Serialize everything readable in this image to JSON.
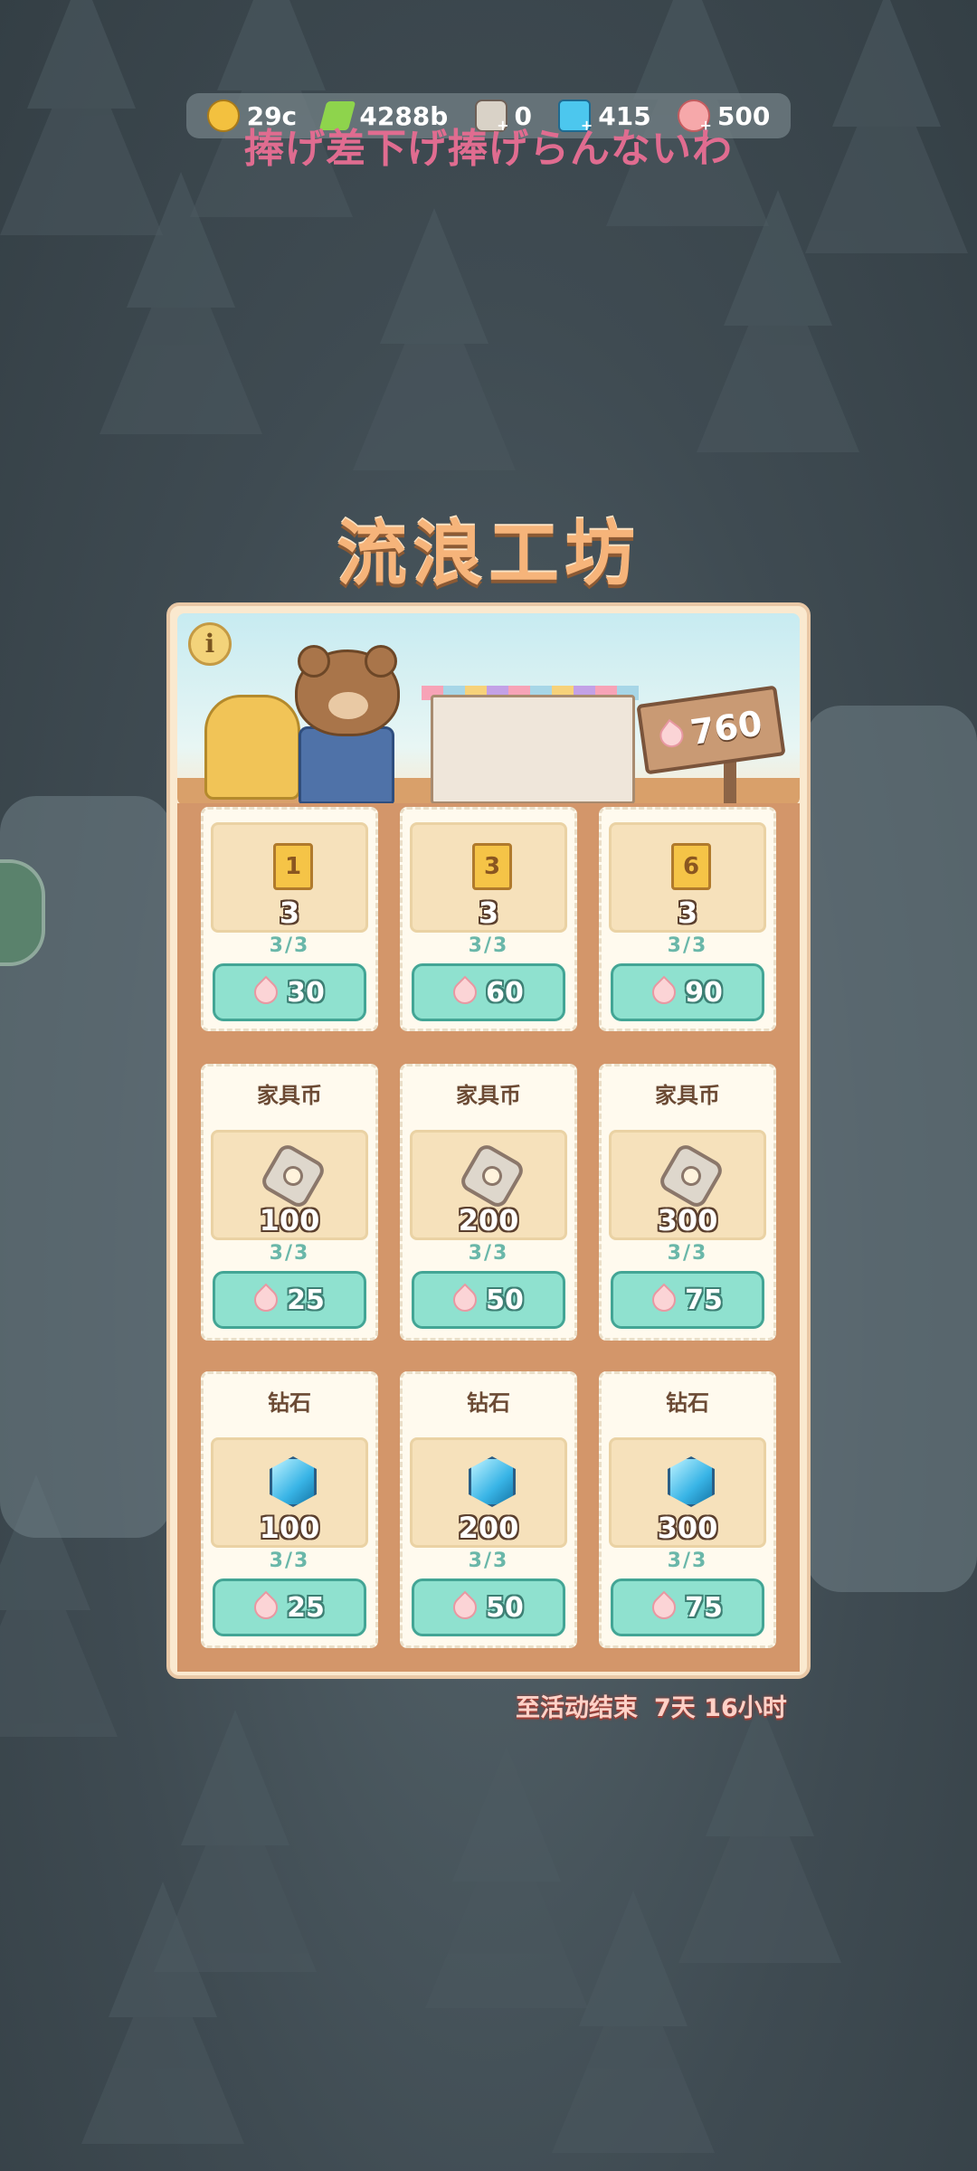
{
  "hud": {
    "coins": "29c",
    "energy": "4288b",
    "furniture_coins": "0",
    "diamonds": "415",
    "petals": "500",
    "colors": {
      "coin": "#f3c13f",
      "energy": "#8ed44c",
      "nut": "#d9d2c7",
      "diamond": "#4cc7ee",
      "petal": "#f6a8aa"
    }
  },
  "overlay_text": "捧げ差下げ捧げらんないわ",
  "title": "流浪工坊",
  "banner": {
    "info_label": "i",
    "currency_amount": "760"
  },
  "cards": [
    {
      "head": "",
      "type": "ticket",
      "ticket_num": "1",
      "amount": "3",
      "limit": "3/3",
      "price": "30"
    },
    {
      "head": "",
      "type": "ticket",
      "ticket_num": "3",
      "amount": "3",
      "limit": "3/3",
      "price": "60"
    },
    {
      "head": "",
      "type": "ticket",
      "ticket_num": "6",
      "amount": "3",
      "limit": "3/3",
      "price": "90"
    },
    {
      "head": "家具币",
      "type": "nut",
      "amount": "100",
      "limit": "3/3",
      "price": "25"
    },
    {
      "head": "家具币",
      "type": "nut",
      "amount": "200",
      "limit": "3/3",
      "price": "50"
    },
    {
      "head": "家具币",
      "type": "nut",
      "amount": "300",
      "limit": "3/3",
      "price": "75"
    },
    {
      "head": "钻石",
      "type": "gem",
      "amount": "100",
      "limit": "3/3",
      "price": "25"
    },
    {
      "head": "钻石",
      "type": "gem",
      "amount": "200",
      "limit": "3/3",
      "price": "50"
    },
    {
      "head": "钻石",
      "type": "gem",
      "amount": "300",
      "limit": "3/3",
      "price": "75"
    }
  ],
  "timer": {
    "label": "至活动结束",
    "value": "7天 16小时"
  }
}
